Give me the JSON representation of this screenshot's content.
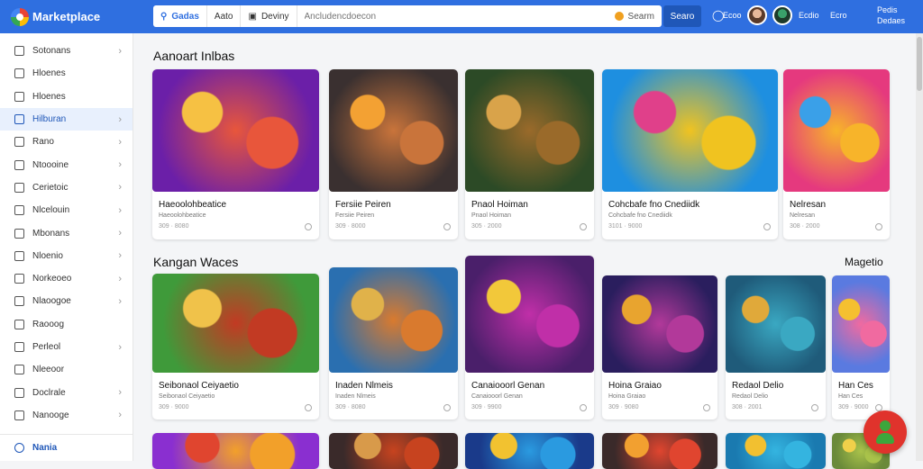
{
  "app": {
    "title": "Marketplace"
  },
  "search": {
    "tab_games": "Gadas",
    "tab_apps": "Aato",
    "tab_device": "Deviny",
    "placeholder": "Ancludencdoecon",
    "sort_label": "Searm",
    "button": "Searo"
  },
  "header": {
    "icon_label": "Ecoo",
    "user_label": "Ecdio",
    "user_label2": "Ecro",
    "right_line1": "Pedis",
    "right_line2": "Dedaes"
  },
  "sidebar": {
    "items": [
      {
        "label": "Sotonans",
        "chevron": true
      },
      {
        "label": "Hloenes",
        "chevron": false
      },
      {
        "label": "Hloenes",
        "chevron": false
      },
      {
        "label": "Hilburan",
        "chevron": true,
        "active": true
      },
      {
        "label": "Rano",
        "chevron": true
      },
      {
        "label": "Ntoooine",
        "chevron": true
      },
      {
        "label": "Cerietoic",
        "chevron": true
      },
      {
        "label": "Nlcelouin",
        "chevron": true
      },
      {
        "label": "Mbonans",
        "chevron": true
      },
      {
        "label": "Nloenio",
        "chevron": true
      },
      {
        "label": "Norkeoeo",
        "chevron": true
      },
      {
        "label": "Nlaoogoe",
        "chevron": true
      },
      {
        "label": "Raooog",
        "chevron": false
      },
      {
        "label": "Perleol",
        "chevron": true
      },
      {
        "label": "Nleeoor",
        "chevron": false
      },
      {
        "label": "Doclrale",
        "chevron": true
      },
      {
        "label": "Nanooge",
        "chevron": true
      }
    ],
    "bottom": "Nania"
  },
  "sections": [
    {
      "title": "Aanoart Inlbas",
      "more": "",
      "cards": [
        {
          "title": "Haeoolohbeatice",
          "sub": "Haeoolohbeatice",
          "meta": "309 · 8080",
          "palette": [
            "#6b1fa8",
            "#e8563b",
            "#f6c143"
          ]
        },
        {
          "title": "Fersiie Peiren",
          "sub": "Fersiie Peiren",
          "meta": "309 · 8000",
          "palette": [
            "#3a3030",
            "#c9743b",
            "#f3a133"
          ]
        },
        {
          "title": "Pnaol Hoiman",
          "sub": "Pnaol Hoiman",
          "meta": "305 · 2000",
          "palette": [
            "#2c4a26",
            "#9a6a2a",
            "#d9a34a"
          ]
        },
        {
          "title": "Cohcbafe fno Cnediidk",
          "sub": "Cohcbafe fno Cnediidk",
          "meta": "3101 · 9000",
          "palette": [
            "#1e8fe0",
            "#f0c320",
            "#e0408a"
          ]
        },
        {
          "title": "Nelresan",
          "sub": "Nelresan",
          "meta": "308 · 2000",
          "palette": [
            "#e5397e",
            "#f7b42a",
            "#3aa0e8"
          ]
        }
      ]
    },
    {
      "title": "Kangan Waces",
      "more": "Magetio",
      "cards": [
        {
          "title": "Seibonaol Ceiyaetio",
          "sub": "Seibonaol Ceiyaetio",
          "meta": "309 · 9000",
          "palette": [
            "#3f9a3a",
            "#c23a23",
            "#f0c24a"
          ]
        },
        {
          "title": "Inaden Nlmeis",
          "sub": "Inaden Nlmeis",
          "meta": "309 · 8080",
          "palette": [
            "#2a6fb0",
            "#d97a2e",
            "#e0b24a"
          ]
        },
        {
          "title": "Canaiooorl Genan",
          "sub": "Canaiooorl Genan",
          "meta": "309 · 9900",
          "palette": [
            "#4a1f6a",
            "#c02fa8",
            "#f2c83a"
          ]
        },
        {
          "title": "Hoina Graiao",
          "sub": "Hoina Graiao",
          "meta": "309 · 9080",
          "palette": [
            "#2a1e5e",
            "#b2399a",
            "#e8a42f"
          ]
        },
        {
          "title": "Redaol Delio",
          "sub": "Redaol Delio",
          "meta": "308 · 2001",
          "palette": [
            "#1f5b7a",
            "#3aa8c2",
            "#e0a93a"
          ]
        },
        {
          "title": "Han Ces",
          "sub": "Han Ces",
          "meta": "309 · 9000",
          "palette": [
            "#5a7ae0",
            "#f06aa0",
            "#f5c030"
          ]
        }
      ]
    },
    {
      "title": "",
      "more": "",
      "cards": [
        {
          "title": "",
          "palette": [
            "#8a2fd0",
            "#f2a02a",
            "#e0452f"
          ]
        },
        {
          "title": "",
          "palette": [
            "#3a2a2a",
            "#c7431f",
            "#d89a4a"
          ]
        },
        {
          "title": "",
          "palette": [
            "#1a3a8a",
            "#2a9ae0",
            "#f2c230"
          ]
        },
        {
          "title": "",
          "palette": [
            "#3a2a2a",
            "#e0452f",
            "#f2a030"
          ]
        },
        {
          "title": "",
          "palette": [
            "#1a7ab0",
            "#34b4e0",
            "#f2c030"
          ]
        },
        {
          "title": "",
          "palette": [
            "#6a8a3a",
            "#a9c24a",
            "#f0d04a"
          ]
        }
      ]
    }
  ],
  "colors": {
    "accent": "#2f6fe0",
    "fab": "#e0332c"
  }
}
